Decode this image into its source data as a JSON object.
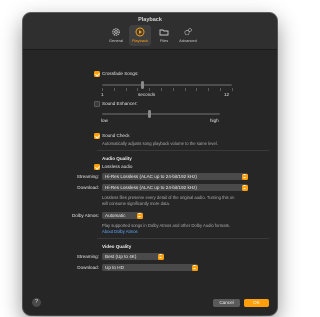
{
  "window": {
    "title": "Playback"
  },
  "tabs": [
    {
      "label": "General",
      "icon": "gear-icon"
    },
    {
      "label": "Playback",
      "icon": "play-icon"
    },
    {
      "label": "Files",
      "icon": "folder-icon"
    },
    {
      "label": "Advanced",
      "icon": "gears-icon"
    }
  ],
  "active_tab": "Playback",
  "crossfade": {
    "label": "Crossfade Songs:",
    "checked": true,
    "min_label": "1",
    "mid_label": "seconds",
    "max_label": "12"
  },
  "sound_enhancer": {
    "label": "Sound Enhancer:",
    "checked": false,
    "low_label": "low",
    "high_label": "high"
  },
  "sound_check": {
    "label": "Sound Check",
    "checked": true,
    "description": "Automatically adjusts song playback volume to the same level."
  },
  "audio_quality": {
    "heading": "Audio Quality",
    "lossless_label": "Lossless audio",
    "lossless_checked": true,
    "streaming_label": "Streaming:",
    "streaming_value": "Hi-Res Lossless (ALAC up to 24-bit/192 kHz)",
    "download_label": "Download:",
    "download_value": "Hi-Res Lossless (ALAC up to 24-bit/192 kHz)",
    "description_line1": "Lossless files preserve every detail of the original audio. Turning this on",
    "description_line2": "will consume significantly more data."
  },
  "dolby": {
    "label": "Dolby Atmos:",
    "value": "Automatic",
    "description": "Play supported songs in Dolby Atmos and other Dolby Audio formats.",
    "link": "About Dolby Atmos"
  },
  "video_quality": {
    "heading": "Video Quality",
    "streaming_label": "Streaming:",
    "streaming_value": "Best (Up to 4K)",
    "download_label": "Download:",
    "download_value": "Up to HD"
  },
  "footer": {
    "help": "?",
    "cancel": "Cancel",
    "ok": "OK"
  },
  "colors": {
    "accent": "#ff9f0a",
    "window_bg": "#262626",
    "link": "#5fa8ff"
  }
}
